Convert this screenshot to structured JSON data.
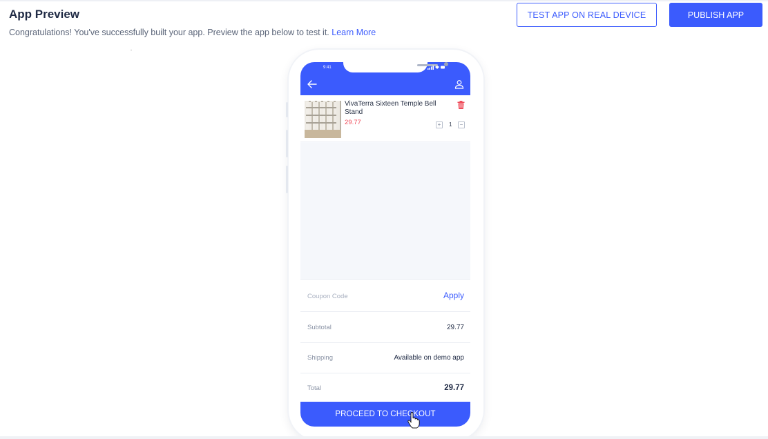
{
  "header": {
    "title": "App Preview",
    "subtitle": "Congratulations! You've successfully built your app. Preview the app below to test it.",
    "learn_more": "Learn More",
    "test_button": "TEST APP ON REAL DEVICE",
    "publish_button": "PUBLISH APP"
  },
  "colors": {
    "accent": "#3b5bfd",
    "price": "#ef4d5b"
  },
  "phone": {
    "status_time": "9:41",
    "status_icons": "signal-wifi-battery",
    "header_icons": [
      "back-arrow-icon",
      "user-icon"
    ],
    "cart": {
      "items": [
        {
          "name": "VivaTerra Sixteen Temple Bell Stand",
          "price": "29.77",
          "quantity": "1",
          "icons": [
            "trash-icon",
            "plus-icon",
            "minus-icon"
          ]
        }
      ],
      "coupon_placeholder": "Coupon Code",
      "apply_label": "Apply",
      "subtotal_label": "Subtotal",
      "subtotal_value": "29.77",
      "shipping_label": "Shipping",
      "shipping_value": "Available on demo app",
      "total_label": "Total",
      "total_value": "29.77",
      "checkout_label": "PROCEED TO CHECKOUT"
    }
  }
}
